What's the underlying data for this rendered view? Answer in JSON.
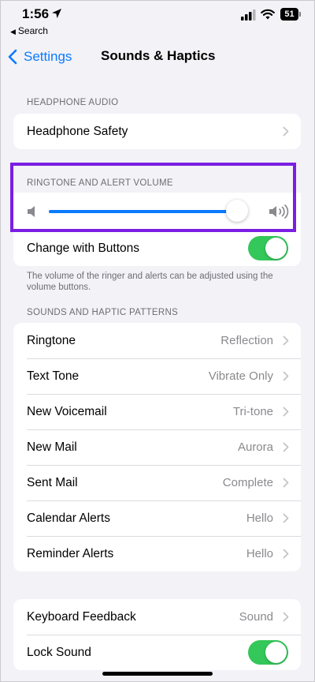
{
  "status_bar": {
    "time": "1:56",
    "back_app": "Search",
    "battery": "51"
  },
  "nav": {
    "back_label": "Settings",
    "title": "Sounds & Haptics"
  },
  "headphone": {
    "header": "HEADPHONE AUDIO",
    "item": {
      "label": "Headphone Safety"
    }
  },
  "volume": {
    "header": "RINGTONE AND ALERT VOLUME",
    "level_percent": 95,
    "change_with_buttons": {
      "label": "Change with Buttons",
      "on": true
    },
    "footnote": "The volume of the ringer and alerts can be adjusted using the volume buttons."
  },
  "patterns": {
    "header": "SOUNDS AND HAPTIC PATTERNS",
    "items": [
      {
        "label": "Ringtone",
        "value": "Reflection"
      },
      {
        "label": "Text Tone",
        "value": "Vibrate Only"
      },
      {
        "label": "New Voicemail",
        "value": "Tri-tone"
      },
      {
        "label": "New Mail",
        "value": "Aurora"
      },
      {
        "label": "Sent Mail",
        "value": "Complete"
      },
      {
        "label": "Calendar Alerts",
        "value": "Hello"
      },
      {
        "label": "Reminder Alerts",
        "value": "Hello"
      }
    ]
  },
  "feedback": {
    "keyboard": {
      "label": "Keyboard Feedback",
      "value": "Sound"
    },
    "lock_sound": {
      "label": "Lock Sound",
      "on": true
    }
  },
  "colors": {
    "accent": "#0a7aff",
    "toggle_on": "#34c759",
    "highlight": "#7a1ee3"
  }
}
